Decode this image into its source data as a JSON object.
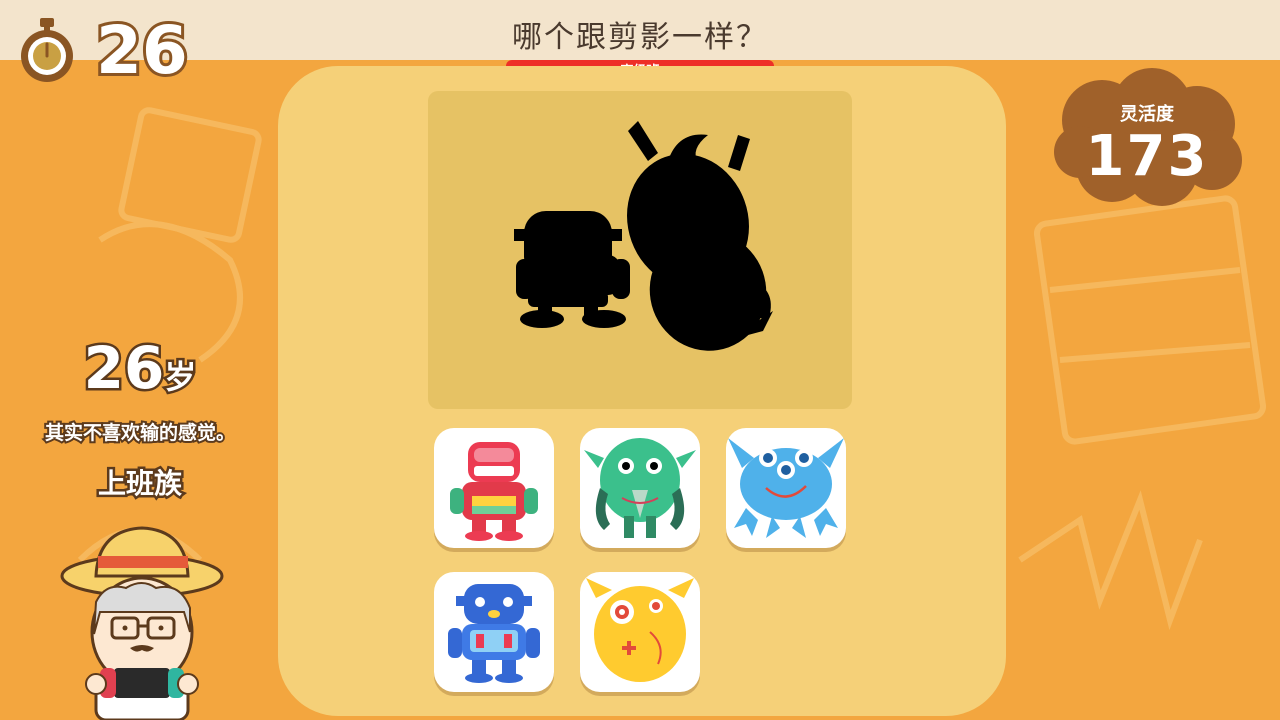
{
  "header": {
    "timer_value": "26",
    "question": "哪个跟剪影一样？",
    "difficulty": "高级班"
  },
  "stat": {
    "label": "灵活度",
    "value": "173"
  },
  "player": {
    "age": "26",
    "age_unit": "岁",
    "comment": "其实不喜欢输的感觉。",
    "title": "上班族"
  },
  "choices": [
    {
      "icon": "red-robot-icon"
    },
    {
      "icon": "green-monster-icon"
    },
    {
      "icon": "blue-three-eyed-monster-icon"
    },
    {
      "icon": "blue-robot-icon"
    },
    {
      "icon": "yellow-monster-icon"
    }
  ],
  "colors": {
    "background": "#f3a63f",
    "panel": "#f5d078",
    "badge": "#ee2f27",
    "stat_cloud": "#a0612a"
  }
}
